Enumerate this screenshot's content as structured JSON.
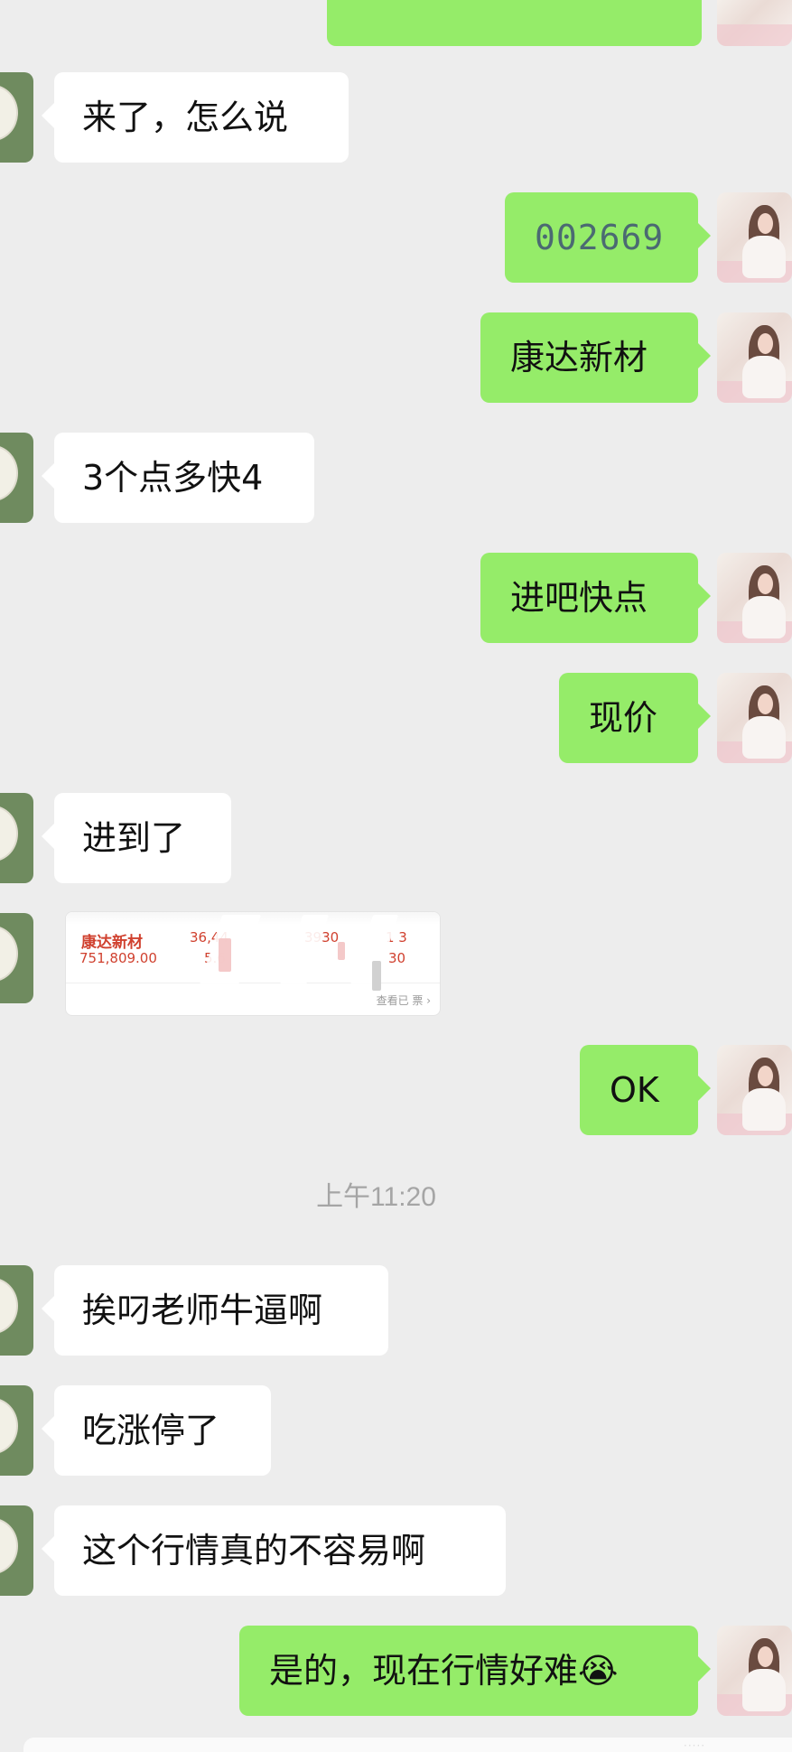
{
  "messages": [
    {
      "text": "来了，怎么说",
      "sender": "contact"
    },
    {
      "text": "002669",
      "sender": "self"
    },
    {
      "text": "康达新材",
      "sender": "self"
    },
    {
      "text": "3个点多快4",
      "sender": "contact"
    },
    {
      "text": "进吧快点",
      "sender": "self"
    },
    {
      "text": "现价",
      "sender": "self"
    },
    {
      "text": "进到了",
      "sender": "contact"
    },
    {
      "type": "stock-card",
      "sender": "contact",
      "stock_name": "康达新材",
      "amount": "751,809.00",
      "col1": "36,44",
      "col2": "5.6",
      "col3": "3930",
      "col4": "1 3",
      "col5": "30",
      "footer": "查看已 票 ›"
    },
    {
      "text": "OK",
      "sender": "self"
    },
    {
      "text": "挨叼老师牛逼啊",
      "sender": "contact"
    },
    {
      "text": "吃涨停了",
      "sender": "contact"
    },
    {
      "text": "这个行情真的不容易啊",
      "sender": "contact"
    },
    {
      "text": "是的，现在行情好难😭",
      "sender": "self"
    }
  ],
  "timestamp": "上午11:20",
  "colors": {
    "background": "#ededed",
    "incoming_bubble": "#ffffff",
    "outgoing_bubble": "#95ec69",
    "timestamp_text": "#a5a5a5",
    "stock_text": "#d0412f"
  },
  "icons": {
    "contact_avatar": "flower-avatar-icon",
    "self_avatar": "woman-photo-avatar-icon"
  }
}
